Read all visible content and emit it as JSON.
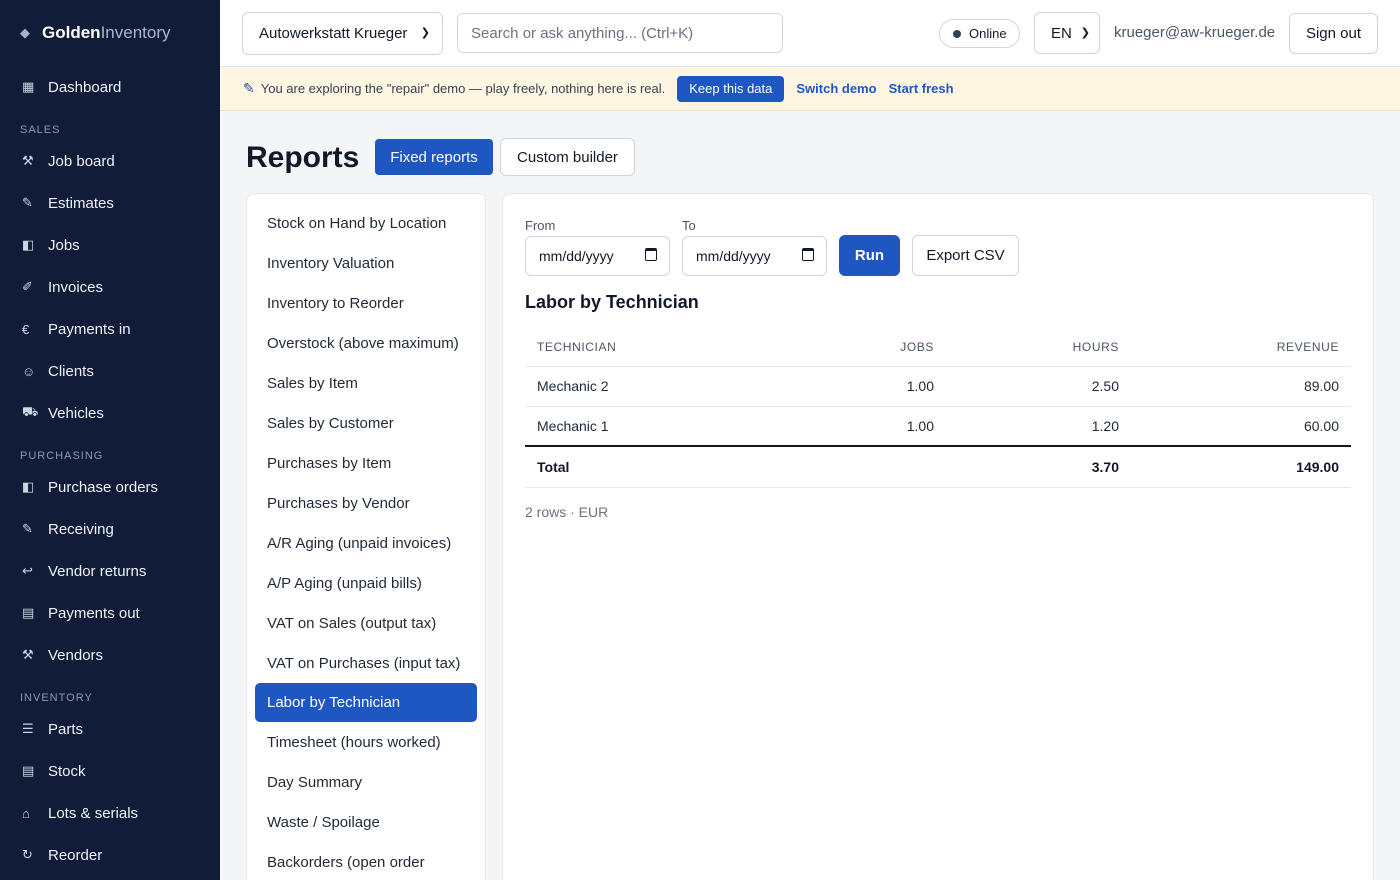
{
  "app": {
    "brand_bold": "Golden",
    "brand_light": "Inventory"
  },
  "sidebar": {
    "top": {
      "label": "Dashboard",
      "icon": "grid-icon"
    },
    "sections": [
      {
        "title": "SALES",
        "items": [
          {
            "label": "Job board",
            "icon": "tools-icon"
          },
          {
            "label": "Estimates",
            "icon": "pencil-icon"
          },
          {
            "label": "Jobs",
            "icon": "panel-icon"
          },
          {
            "label": "Invoices",
            "icon": "pen-icon"
          },
          {
            "label": "Payments in",
            "icon": "euro-icon"
          },
          {
            "label": "Clients",
            "icon": "smiley-icon"
          },
          {
            "label": "Vehicles",
            "icon": "car-icon"
          }
        ]
      },
      {
        "title": "PURCHASING",
        "items": [
          {
            "label": "Purchase orders",
            "icon": "panel-icon"
          },
          {
            "label": "Receiving",
            "icon": "pencil-icon"
          },
          {
            "label": "Vendor returns",
            "icon": "return-icon"
          },
          {
            "label": "Payments out",
            "icon": "receipt-icon"
          },
          {
            "label": "Vendors",
            "icon": "hammer-icon"
          }
        ]
      },
      {
        "title": "INVENTORY",
        "items": [
          {
            "label": "Parts",
            "icon": "list-icon"
          },
          {
            "label": "Stock",
            "icon": "stock-icon"
          },
          {
            "label": "Lots & serials",
            "icon": "tag-icon"
          },
          {
            "label": "Reorder",
            "icon": "refresh-icon"
          }
        ]
      }
    ]
  },
  "topbar": {
    "company": "Autowerkstatt Krueger",
    "search_placeholder": "Search or ask anything...  (Ctrl+K)",
    "status": "Online",
    "language": "EN",
    "email": "krueger@aw-krueger.de",
    "sign_out": "Sign out"
  },
  "banner": {
    "message": "You are exploring the \"repair\" demo — play freely, nothing here is real.",
    "keep": "Keep this data",
    "switch": "Switch demo",
    "fresh": "Start fresh"
  },
  "page": {
    "title": "Reports",
    "tab_fixed": "Fixed reports",
    "tab_custom": "Custom builder"
  },
  "reports": [
    "Stock on Hand by Location",
    "Inventory Valuation",
    "Inventory to Reorder",
    "Overstock (above maximum)",
    "Sales by Item",
    "Sales by Customer",
    "Purchases by Item",
    "Purchases by Vendor",
    "A/R Aging (unpaid invoices)",
    "A/P Aging (unpaid bills)",
    "VAT on Sales (output tax)",
    "VAT on Purchases (input tax)",
    "Labor by Technician",
    "Timesheet (hours worked)",
    "Day Summary",
    "Waste / Spoilage",
    "Backorders (open order"
  ],
  "active_report_index": 12,
  "filters": {
    "from_label": "From",
    "to_label": "To",
    "from_value": "mm/dd/yyyy",
    "to_value": "mm/dd/yyyy",
    "run": "Run",
    "export": "Export CSV"
  },
  "report": {
    "title": "Labor by Technician",
    "columns": [
      "TECHNICIAN",
      "JOBS",
      "HOURS",
      "REVENUE"
    ],
    "rows": [
      {
        "technician": "Mechanic 2",
        "jobs": "1.00",
        "hours": "2.50",
        "revenue": "89.00"
      },
      {
        "technician": "Mechanic 1",
        "jobs": "1.00",
        "hours": "1.20",
        "revenue": "60.00"
      }
    ],
    "total": {
      "label": "Total",
      "jobs": "",
      "hours": "3.70",
      "revenue": "149.00"
    },
    "footnote": "2 rows · EUR"
  }
}
